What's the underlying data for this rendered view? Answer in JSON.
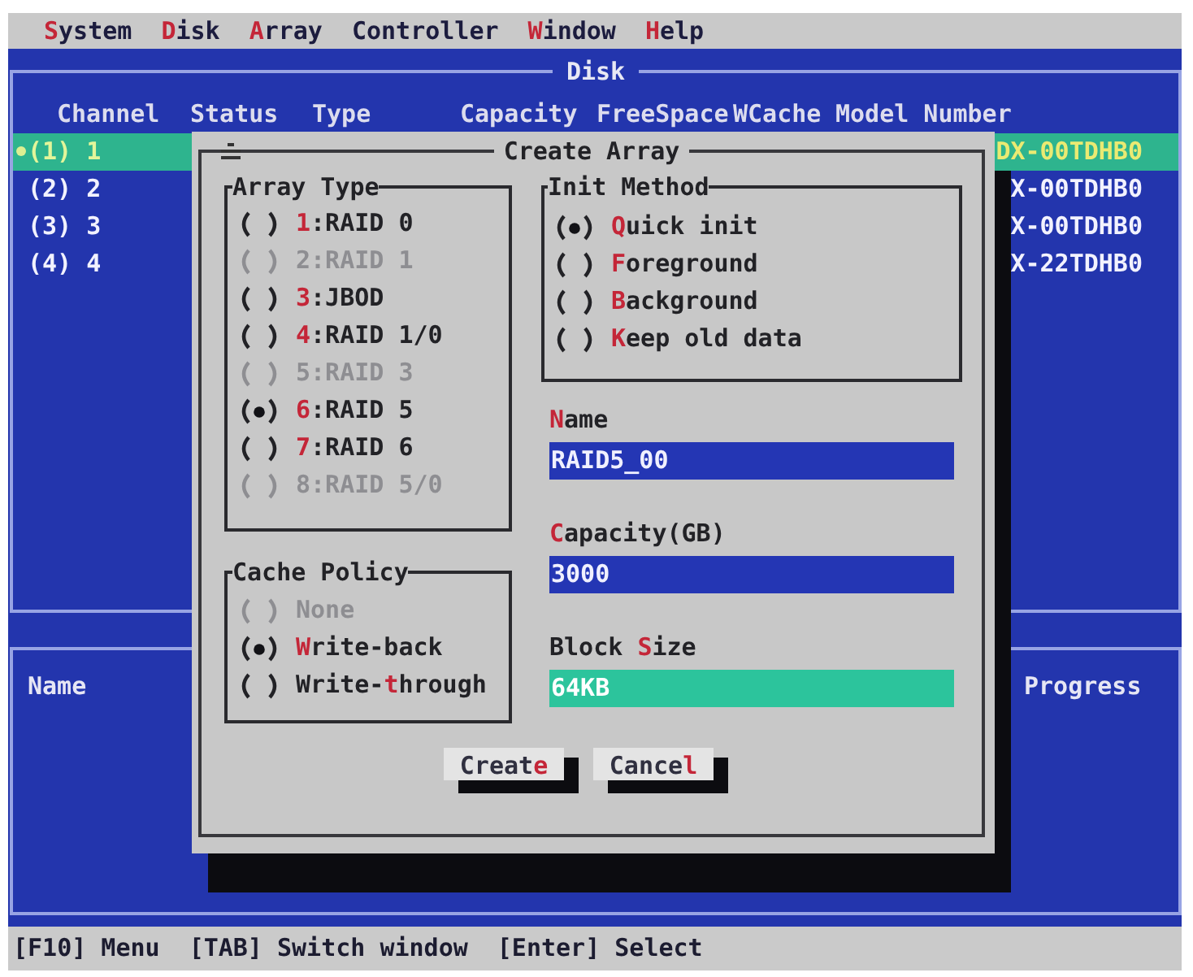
{
  "menu_bar": [
    {
      "label": "**S**ystem"
    },
    {
      "label": "**D**isk"
    },
    {
      "label": "**A**rray"
    },
    {
      "label": "Controller"
    },
    {
      "label": "**W**indow"
    },
    {
      "label": "**H**elp"
    }
  ],
  "disk_window": {
    "title": "Disk",
    "columns": [
      "Channel",
      "Status",
      "Type",
      "Capacity",
      "FreeSpace",
      "WCache",
      "Model Number"
    ],
    "rows": [
      {
        "channel": "(1) 1",
        "model_number": "DX-00TDHB0",
        "selected": true
      },
      {
        "channel": "(2) 2",
        "model_number": "X-00TDHB0",
        "selected": false
      },
      {
        "channel": "(3) 3",
        "model_number": "X-00TDHB0",
        "selected": false
      },
      {
        "channel": "(4) 4",
        "model_number": "X-22TDHB0",
        "selected": false
      }
    ]
  },
  "array_window": {
    "columns": [
      "Name",
      "Progress"
    ]
  },
  "create_array_dialog": {
    "title": "Create Array",
    "array_type": {
      "title": "Array Type",
      "options": [
        {
          "label": "**1**:RAID 0",
          "selected": false,
          "disabled": false
        },
        {
          "label": "2:RAID 1",
          "selected": false,
          "disabled": true
        },
        {
          "label": "**3**:JBOD",
          "selected": false,
          "disabled": false
        },
        {
          "label": "**4**:RAID 1/0",
          "selected": false,
          "disabled": false
        },
        {
          "label": "5:RAID 3",
          "selected": false,
          "disabled": true
        },
        {
          "label": "**6**:RAID 5",
          "selected": true,
          "disabled": false
        },
        {
          "label": "**7**:RAID 6",
          "selected": false,
          "disabled": false
        },
        {
          "label": "8:RAID 5/0",
          "selected": false,
          "disabled": true
        }
      ]
    },
    "cache_policy": {
      "title": "Cache Policy",
      "options": [
        {
          "label": "None",
          "selected": false,
          "disabled": true
        },
        {
          "label": "**W**rite-back",
          "selected": true,
          "disabled": false
        },
        {
          "label": "Write-**t**hrough",
          "selected": false,
          "disabled": false
        }
      ]
    },
    "init_method": {
      "title": "Init Method",
      "options": [
        {
          "label": "**Q**uick init",
          "selected": true,
          "disabled": false
        },
        {
          "label": "**F**oreground",
          "selected": false,
          "disabled": false
        },
        {
          "label": "**B**ackground",
          "selected": false,
          "disabled": false
        },
        {
          "label": "**K**eep old data",
          "selected": false,
          "disabled": false
        }
      ]
    },
    "fields": [
      {
        "label": "**N**ame",
        "value": "RAID5_00",
        "focused": false
      },
      {
        "label": "**C**apacity(GB)",
        "value": "3000",
        "focused": false
      },
      {
        "label": "Block **S**ize",
        "value": "64KB",
        "focused": true
      }
    ],
    "buttons": [
      {
        "label": "Creat**e**"
      },
      {
        "label": "Cance**l**"
      }
    ]
  },
  "status_bar": [
    "[F10] Menu",
    "[TAB] Switch window",
    "[Enter] Select"
  ]
}
